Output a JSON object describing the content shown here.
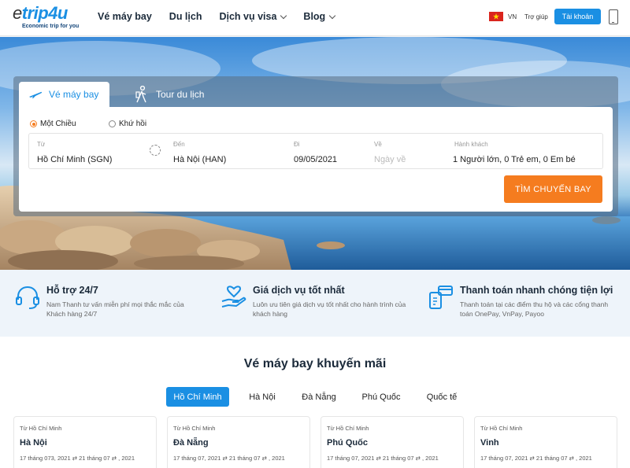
{
  "header": {
    "logo_text_e": "e",
    "logo_text_rest": "trip4u",
    "logo_tagline": "Economic trip for you",
    "nav": [
      {
        "label": "Vé máy bay",
        "dropdown": false
      },
      {
        "label": "Du lịch",
        "dropdown": false
      },
      {
        "label": "Dịch vụ visa",
        "dropdown": true
      },
      {
        "label": "Blog",
        "dropdown": true
      }
    ],
    "lang": "VN",
    "help": "Trợ giúp",
    "account": "Tài khoản"
  },
  "search": {
    "tab_flight": "Vé máy bay",
    "tab_tour": "Tour du lịch",
    "trip_one_way": "Một Chiều",
    "trip_round": "Khứ hồi",
    "selected_trip": "one_way",
    "from_label": "Từ",
    "from_value": "Hồ Chí Minh (SGN)",
    "to_label": "Đến",
    "to_value": "Hà Nội (HAN)",
    "depart_label": "Đi",
    "depart_value": "09/05/2021",
    "return_label": "Về",
    "return_placeholder": "Ngày về",
    "pax_label": "Hành khách",
    "pax_value": "1 Người lớn, 0 Trẻ em, 0 Em bé",
    "submit": "TÌM CHUYẾN BAY"
  },
  "features": [
    {
      "title": "Hỗ trợ 24/7",
      "desc": "Nam Thanh tư vấn miễn phí mọi thắc mắc của Khách hàng 24/7",
      "icon": "headset-icon"
    },
    {
      "title": "Giá dịch vụ tốt nhất",
      "desc": "Luôn ưu tiên giá dịch vụ tốt nhất cho hành trình của khách hàng",
      "icon": "heart-hand-icon"
    },
    {
      "title": "Thanh toán nhanh chóng tiện lợi",
      "desc": "Thanh toán tại các điểm thu hộ và các cổng thanh toán OnePay, VnPay, Payoo",
      "icon": "payment-icon"
    }
  ],
  "promo": {
    "title": "Vé máy bay khuyến mãi",
    "tabs": [
      "Hồ Chí Minh",
      "Hà Nội",
      "Đà Nẵng",
      "Phú Quốc",
      "Quốc tế"
    ],
    "active_tab": 0,
    "cards": [
      {
        "from": "Từ Hồ Chí Minh",
        "to": "Hà Nội",
        "dates": "17 tháng 073, 2021   ⇄   21 tháng 07   ⇄   , 2021"
      },
      {
        "from": "Từ Hồ Chí Minh",
        "to": "Đà Nẵng",
        "dates": "17 tháng 07, 2021   ⇄   21 tháng 07   ⇄   , 2021"
      },
      {
        "from": "Từ Hồ Chí Minh",
        "to": "Phú Quốc",
        "dates": "17 tháng 07, 2021   ⇄   21 tháng 07   ⇄   , 2021"
      },
      {
        "from": "Từ Hồ Chí Minh",
        "to": "Vinh",
        "dates": "17 tháng 07, 2021   ⇄   21 tháng 07   ⇄   , 2021"
      }
    ]
  },
  "colors": {
    "brand": "#1a8fe3",
    "accent": "#f57c1f"
  }
}
